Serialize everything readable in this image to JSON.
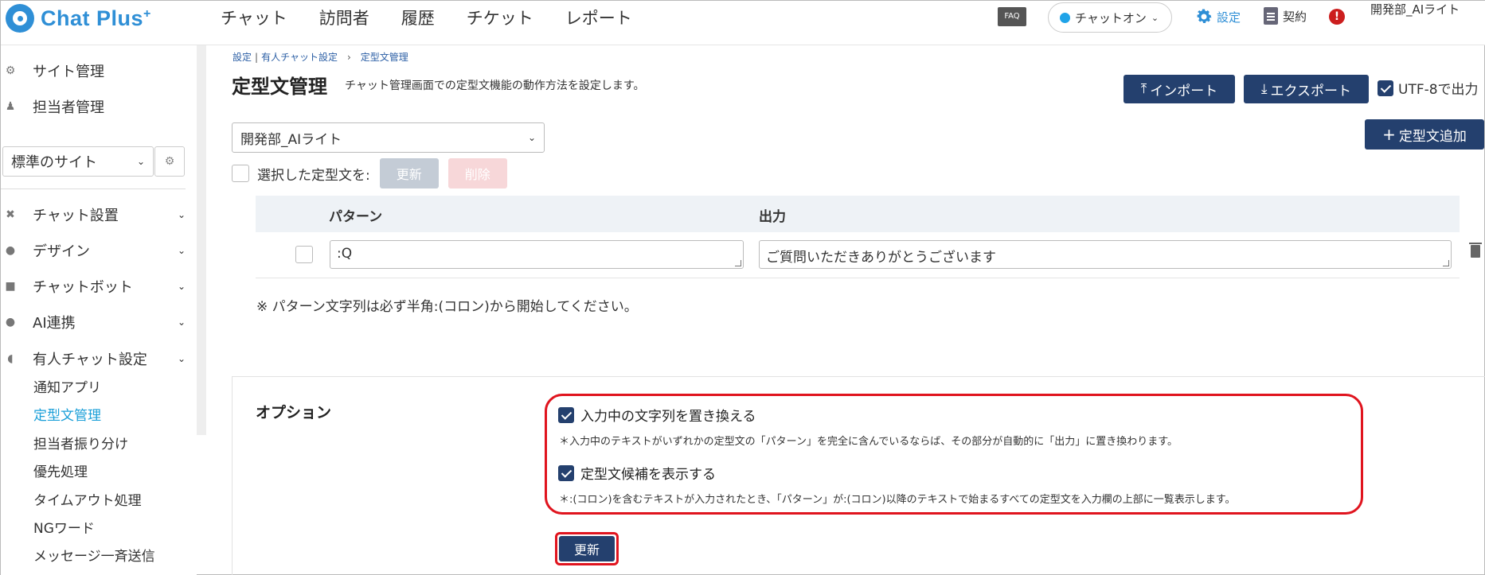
{
  "header": {
    "logo_text": "Chat Plus",
    "logo_plus": "+",
    "nav": [
      "チャット",
      "訪問者",
      "履歴",
      "チケット",
      "レポート"
    ],
    "faq_label": "FAQ",
    "chat_toggle_label": "チャットオン",
    "settings_label": "設定",
    "contract_label": "契約",
    "alert_symbol": "!",
    "user_name": "開発部_AIライト"
  },
  "sidebar": {
    "top_items": [
      {
        "label": "サイト管理",
        "icon": "gear-icon"
      },
      {
        "label": "担当者管理",
        "icon": "users-icon"
      }
    ],
    "site_select_value": "標準のサイト",
    "sections": [
      {
        "label": "チャット設置",
        "icon": "tools-icon"
      },
      {
        "label": "デザイン",
        "icon": "palette-icon"
      },
      {
        "label": "チャットボット",
        "icon": "chat-icon"
      },
      {
        "label": "AI連携",
        "icon": "bulb-icon"
      },
      {
        "label": "有人チャット設定",
        "icon": "headset-icon"
      }
    ],
    "sub_items": [
      "通知アプリ",
      "定型文管理",
      "担当者振り分け",
      "優先処理",
      "タイムアウト処理",
      "NGワード",
      "メッセージ一斉送信"
    ],
    "active_sub_item": "定型文管理"
  },
  "main": {
    "breadcrumb": [
      "設定",
      "有人チャット設定",
      "定型文管理"
    ],
    "breadcrumb_sep1": "|",
    "breadcrumb_sep2": "›",
    "title": "定型文管理",
    "description": "チャット管理画面での定型文機能の動作方法を設定します。",
    "import_label": "インポート",
    "export_label": "エクスポート",
    "utf8_label": "UTF-8で出力",
    "add_label": "定型文追加",
    "department_value": "開発部_AIライト",
    "bulk_label": "選択した定型文を:",
    "bulk_update_label": "更新",
    "bulk_delete_label": "削除",
    "table": {
      "headers": [
        "パターン",
        "出力"
      ],
      "rows": [
        {
          "pattern": ":Q",
          "output": "ご質問いただきありがとうございます"
        }
      ]
    },
    "note": "※ パターン文字列は必ず半角:(コロン)から開始してください。"
  },
  "options": {
    "title": "オプション",
    "option1_label": "入力中の文字列を置き換える",
    "option1_desc": "＊入力中のテキストがいずれかの定型文の「パターン」を完全に含んでいるならば、その部分が自動的に「出力」に置き換わります。",
    "option2_label": "定型文候補を表示する",
    "option2_desc": "＊:(コロン)を含むテキストが入力されたとき、「パターン」が:(コロン)以降のテキストで始まるすべての定型文を入力欄の上部に一覧表示します。",
    "update_label": "更新"
  },
  "colors": {
    "brand": "#2f8fd6",
    "primary_button": "#24406e",
    "highlight_border": "#e0141e",
    "active_link": "#1a9fd8"
  }
}
